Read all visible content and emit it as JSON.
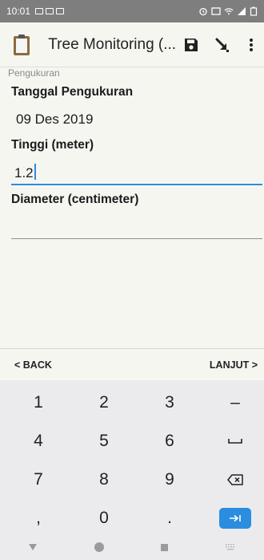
{
  "status_bar": {
    "time": "10:01"
  },
  "app_bar": {
    "title": "Tree Monitoring (...",
    "icons": [
      "clipboard-icon",
      "save-icon",
      "arrow-down-right-icon",
      "more-vert-icon"
    ]
  },
  "form": {
    "group_label": "Pengukuran",
    "fields": [
      {
        "label": "Tanggal Pengukuran",
        "value": "09 Des 2019"
      },
      {
        "label": "Tinggi (meter)",
        "value": "1.2"
      },
      {
        "label": "Diameter (centimeter)",
        "value": ""
      }
    ]
  },
  "nav": {
    "back": "< BACK",
    "next": "LANJUT >"
  },
  "keypad": {
    "keys": [
      [
        "1",
        "2",
        "3",
        "–"
      ],
      [
        "4",
        "5",
        "6",
        "space-icon"
      ],
      [
        "7",
        "8",
        "9",
        "backspace-icon"
      ],
      [
        ",",
        "0",
        ".",
        "enter-icon"
      ]
    ]
  },
  "colors": {
    "accent": "#2b8de0",
    "status_bar": "#7e7e7e",
    "background": "#f6f6f1"
  }
}
